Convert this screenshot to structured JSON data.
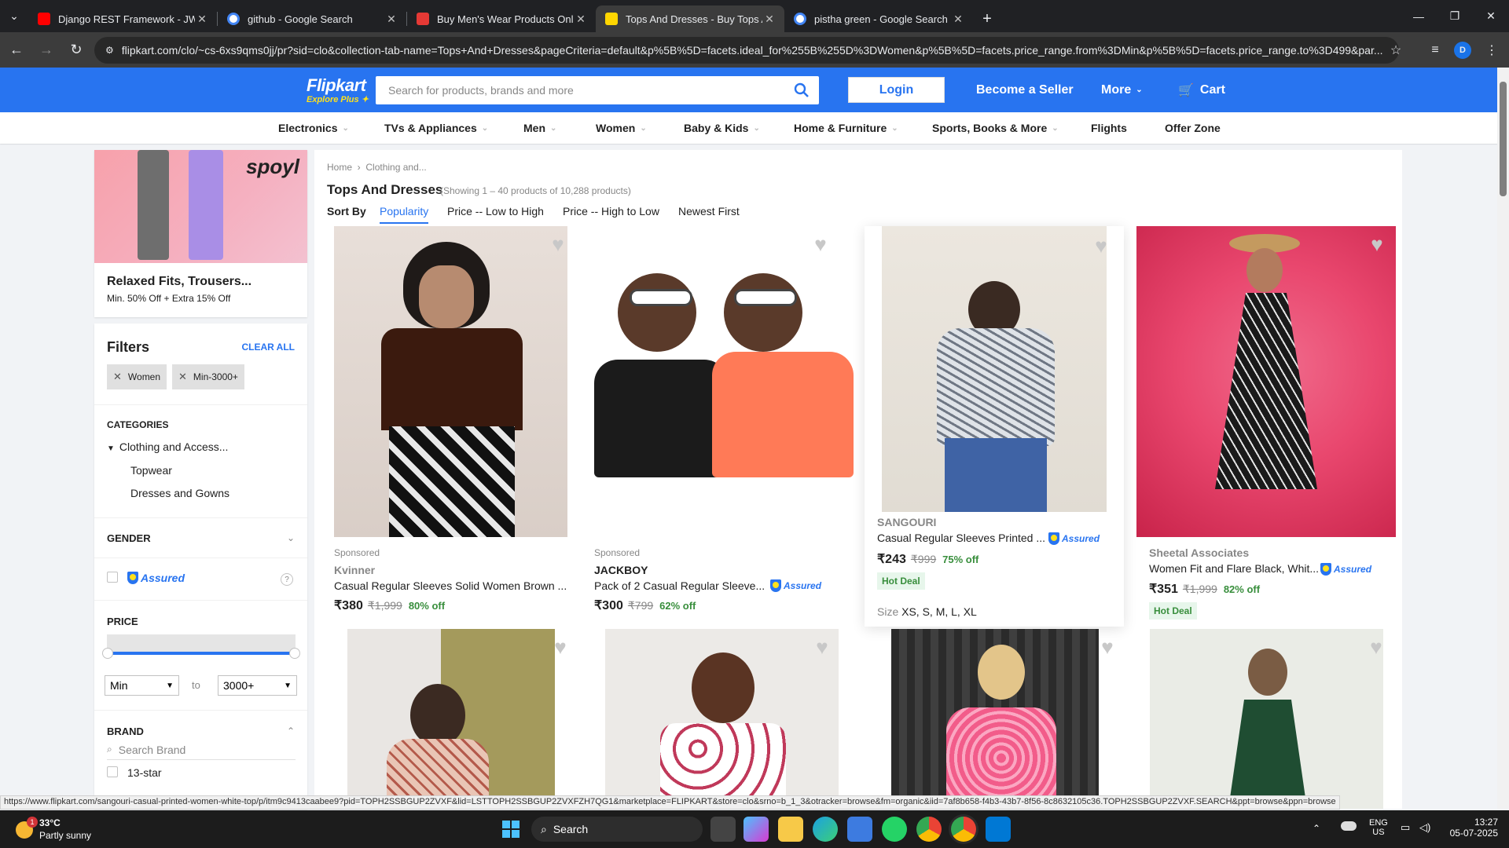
{
  "browser": {
    "tabs": [
      {
        "title": "Django REST Framework - JWT",
        "color": "#ff0000"
      },
      {
        "title": "github - Google Search",
        "color": "#4285f4"
      },
      {
        "title": "Buy Men's Wear Products Onlin",
        "color": "#e53935"
      },
      {
        "title": "Tops And Dresses - Buy Tops Ar",
        "color": "#ffd600"
      },
      {
        "title": "pistha green - Google Search",
        "color": "#4285f4"
      }
    ],
    "active_tab_index": 3,
    "url": "flipkart.com/clo/~cs-6xs9qms0jj/pr?sid=clo&collection-tab-name=Tops+And+Dresses&pageCriteria=default&p%5B%5D=facets.ideal_for%255B%255D%3DWomen&p%5B%5D=facets.price_range.from%3DMin&p%5B%5D=facets.price_range.to%3D499&par...",
    "profile_initial": "D"
  },
  "header": {
    "logo": "Flipkart",
    "logo_sub": "Explore Plus",
    "search_placeholder": "Search for products, brands and more",
    "login": "Login",
    "become_seller": "Become a Seller",
    "more": "More",
    "cart": "Cart"
  },
  "categories": [
    "Electronics",
    "TVs & Appliances",
    "Men",
    "Women",
    "Baby & Kids",
    "Home & Furniture",
    "Sports, Books & More",
    "Flights",
    "Offer Zone"
  ],
  "promo": {
    "brand": "spoyl",
    "title": "Relaxed Fits, Trousers...",
    "subtitle": "Min. 50% Off + Extra 15% Off"
  },
  "filters": {
    "title": "Filters",
    "clear_all": "CLEAR ALL",
    "chips": [
      "Women",
      "Min-3000+"
    ],
    "categories_heading": "CATEGORIES",
    "category_root": "Clothing and Access...",
    "subcategories": [
      "Topwear",
      "Dresses and Gowns"
    ],
    "gender_heading": "GENDER",
    "assured_label": "Assured",
    "price_heading": "PRICE",
    "price_min": "Min",
    "price_to": "to",
    "price_max": "3000+",
    "brand_heading": "BRAND",
    "brand_search_placeholder": "Search Brand",
    "brands": [
      "13-star"
    ]
  },
  "listing": {
    "breadcrumb": [
      "Home",
      "Clothing and..."
    ],
    "title": "Tops And Dresses",
    "count": "(Showing 1 – 40 products of 10,288 products)",
    "sort_by": "Sort By",
    "sort_options": [
      "Popularity",
      "Price -- Low to High",
      "Price -- High to Low",
      "Newest First"
    ],
    "products": [
      {
        "sponsored": "Sponsored",
        "brand": "Kvinner",
        "name": "Casual Regular Sleeves Solid Women Brown ...",
        "assured": false,
        "price": "₹380",
        "mrp": "₹1,999",
        "off": "80% off",
        "hot": "",
        "sizes": ""
      },
      {
        "sponsored": "Sponsored",
        "brand": "JACKBOY",
        "name": "Pack of 2 Casual Regular Sleeve...",
        "assured": true,
        "price": "₹300",
        "mrp": "₹799",
        "off": "62% off",
        "hot": "",
        "sizes": ""
      },
      {
        "sponsored": "",
        "brand": "SANGOURI",
        "name": "Casual Regular Sleeves Printed ...",
        "assured": true,
        "price": "₹243",
        "mrp": "₹999",
        "off": "75% off",
        "hot": "Hot Deal",
        "sizes_label": "Size",
        "sizes": "XS, S, M, L, XL"
      },
      {
        "sponsored": "",
        "brand": "Sheetal Associates",
        "name": "Women Fit and Flare Black, Whit...",
        "assured": true,
        "price": "₹351",
        "mrp": "₹1,999",
        "off": "82% off",
        "hot": "Hot Deal",
        "sizes": ""
      }
    ]
  },
  "status_url": "https://www.flipkart.com/sangouri-casual-printed-women-white-top/p/itm9c9413caabee9?pid=TOPH2SSBGUP2ZVXF&lid=LSTTOPH2SSBGUP2ZVXFZH7QG1&marketplace=FLIPKART&store=clo&srno=b_1_3&otracker=browse&fm=organic&iid=7af8b658-f4b3-43b7-8f56-8c8632105c36.TOPH2SSBGUP2ZVXF.SEARCH&ppt=browse&ppn=browse",
  "taskbar": {
    "weather_temp": "33°C",
    "weather_desc": "Partly sunny",
    "weather_badge": "1",
    "search": "Search",
    "lang1": "ENG",
    "lang2": "US",
    "time": "13:27",
    "date": "05-07-2025"
  },
  "colors": {
    "brand_blue": "#2874f0",
    "brand_yellow": "#ffe11b",
    "offer_green": "#388e3c"
  }
}
